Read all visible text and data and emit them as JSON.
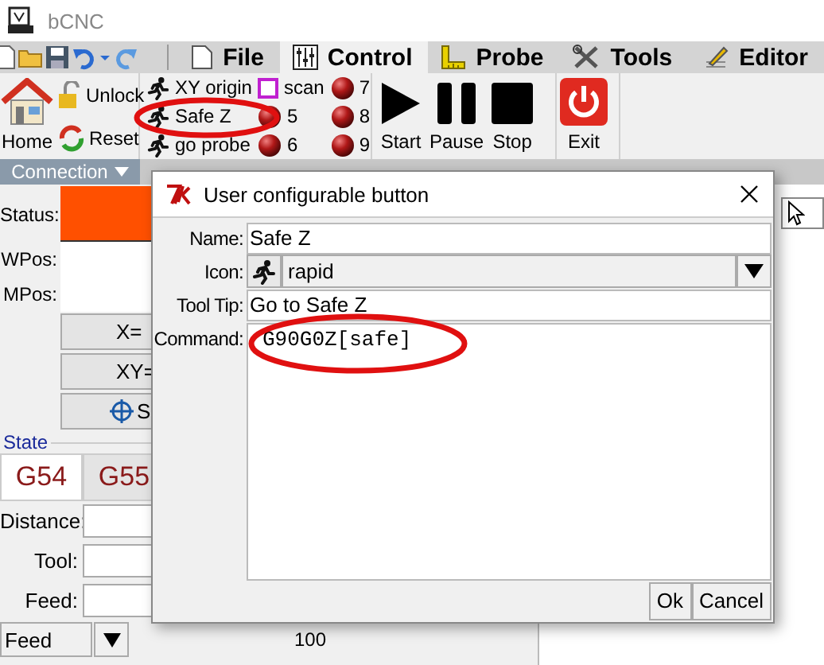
{
  "window": {
    "title": "bCNC"
  },
  "tabs": [
    {
      "label": "File",
      "selected": false
    },
    {
      "label": "Control",
      "selected": true
    },
    {
      "label": "Probe",
      "selected": false
    },
    {
      "label": "Tools",
      "selected": false
    },
    {
      "label": "Editor",
      "selected": false
    }
  ],
  "ribbon": {
    "home": "Home",
    "unlock": "Unlock",
    "reset": "Reset",
    "user_buttons": [
      {
        "label": "XY origin",
        "kind": "run"
      },
      {
        "label": "Safe Z",
        "kind": "run"
      },
      {
        "label": "go probe",
        "kind": "run"
      },
      {
        "label": "scan",
        "kind": "square"
      },
      {
        "label": "5",
        "kind": "ball"
      },
      {
        "label": "6",
        "kind": "ball"
      },
      {
        "label": "7",
        "kind": "ball"
      },
      {
        "label": "8",
        "kind": "ball"
      },
      {
        "label": "9",
        "kind": "ball"
      }
    ],
    "run_buttons": [
      {
        "label": "Start",
        "kind": "play"
      },
      {
        "label": "Pause",
        "kind": "pause"
      },
      {
        "label": "Stop",
        "kind": "stop"
      }
    ],
    "exit": "Exit",
    "group_label": "Connection"
  },
  "control": {
    "status_label": "Status:",
    "wpos_label": "WPos:",
    "mpos_label": "MPos:",
    "buttons": [
      {
        "label": "X=",
        "kind": "plain"
      },
      {
        "label": "XY=",
        "kind": "plain"
      },
      {
        "label": "S",
        "kind": "target"
      }
    ],
    "state_title": "State",
    "wcs": [
      {
        "label": "G54",
        "selected": true
      },
      {
        "label": "G55",
        "selected": false
      }
    ],
    "fields": [
      "Distance:",
      "Tool:",
      "Feed:"
    ],
    "feed_mode": "Feed",
    "override_value": "100"
  },
  "dialog": {
    "title": "User configurable button",
    "name_label": "Name:",
    "name": "Safe Z",
    "icon_label": "Icon:",
    "icon_value": "rapid",
    "tooltip_label": "Tool Tip:",
    "tooltip": "Go to Safe Z",
    "command_label": "Command:",
    "command": "G90G0Z[safe]",
    "buttons": [
      "Ok",
      "Cancel"
    ]
  }
}
